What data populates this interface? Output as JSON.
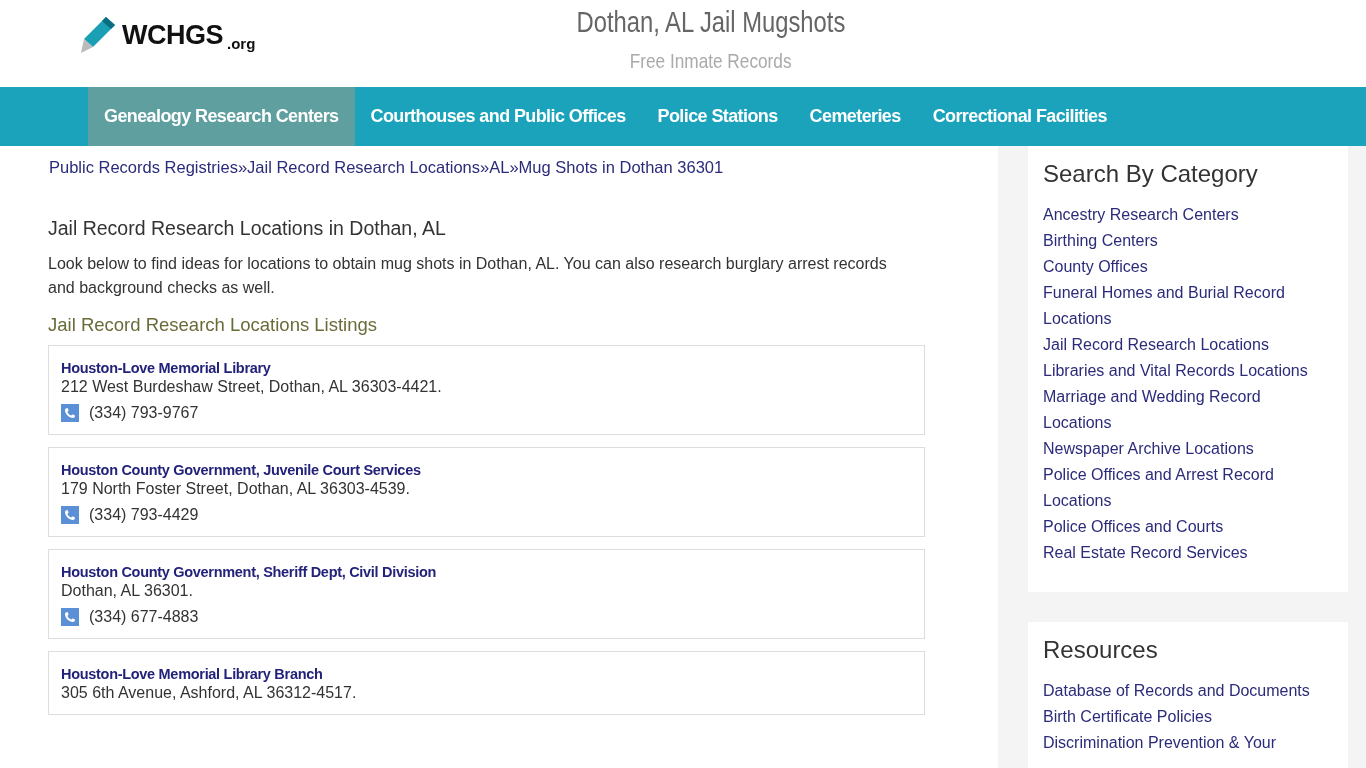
{
  "logo": {
    "name": "WCHGS",
    "suffix": ".org"
  },
  "header": {
    "title": "Dothan, AL Jail Mugshots",
    "subtitle": "Free Inmate Records"
  },
  "nav": [
    {
      "label": "Genealogy Research Centers",
      "selected": true
    },
    {
      "label": "Courthouses and Public Offices",
      "selected": false
    },
    {
      "label": "Police Stations",
      "selected": false
    },
    {
      "label": "Cemeteries",
      "selected": false
    },
    {
      "label": "Correctional Facilities",
      "selected": false
    }
  ],
  "breadcrumb": {
    "separator": "»",
    "items": [
      "Public Records Registries",
      "Jail Record Research Locations",
      "AL",
      "Mug Shots in Dothan 36301"
    ]
  },
  "heading": "Jail Record Research Locations in Dothan, AL",
  "intro": "Look below to find ideas for locations to obtain mug shots in Dothan, AL. You can also research burglary arrest records and background checks as well.",
  "listings_title": "Jail Record Research Locations Listings",
  "listings": [
    {
      "name": "Houston-Love Memorial Library",
      "address": "212 West Burdeshaw Street, Dothan, AL 36303-4421.",
      "phone": "(334) 793-9767"
    },
    {
      "name": "Houston County Government, Juvenile Court Services",
      "address": "179 North Foster Street, Dothan, AL 36303-4539.",
      "phone": "(334) 793-4429"
    },
    {
      "name": "Houston County Government, Sheriff Dept, Civil Division",
      "address": "Dothan, AL 36301.",
      "phone": "(334) 677-4883"
    },
    {
      "name": "Houston-Love Memorial Library Branch",
      "address": "305 6th Avenue, Ashford, AL 36312-4517."
    }
  ],
  "sidebar": [
    {
      "title": "Search By Category",
      "links": [
        "Ancestry Research Centers",
        "Birthing Centers",
        "County Offices",
        "Funeral Homes and Burial Record Locations",
        "Jail Record Research Locations",
        "Libraries and Vital Records Locations",
        "Marriage and Wedding Record Locations",
        "Newspaper Archive Locations",
        "Police Offices and Arrest Record Locations",
        "Police Offices and Courts",
        "Real Estate Record Services"
      ]
    },
    {
      "title": "Resources",
      "links": [
        "Database of Records and Documents",
        "Birth Certificate Policies",
        "Discrimination Prevention & Your"
      ]
    }
  ]
}
